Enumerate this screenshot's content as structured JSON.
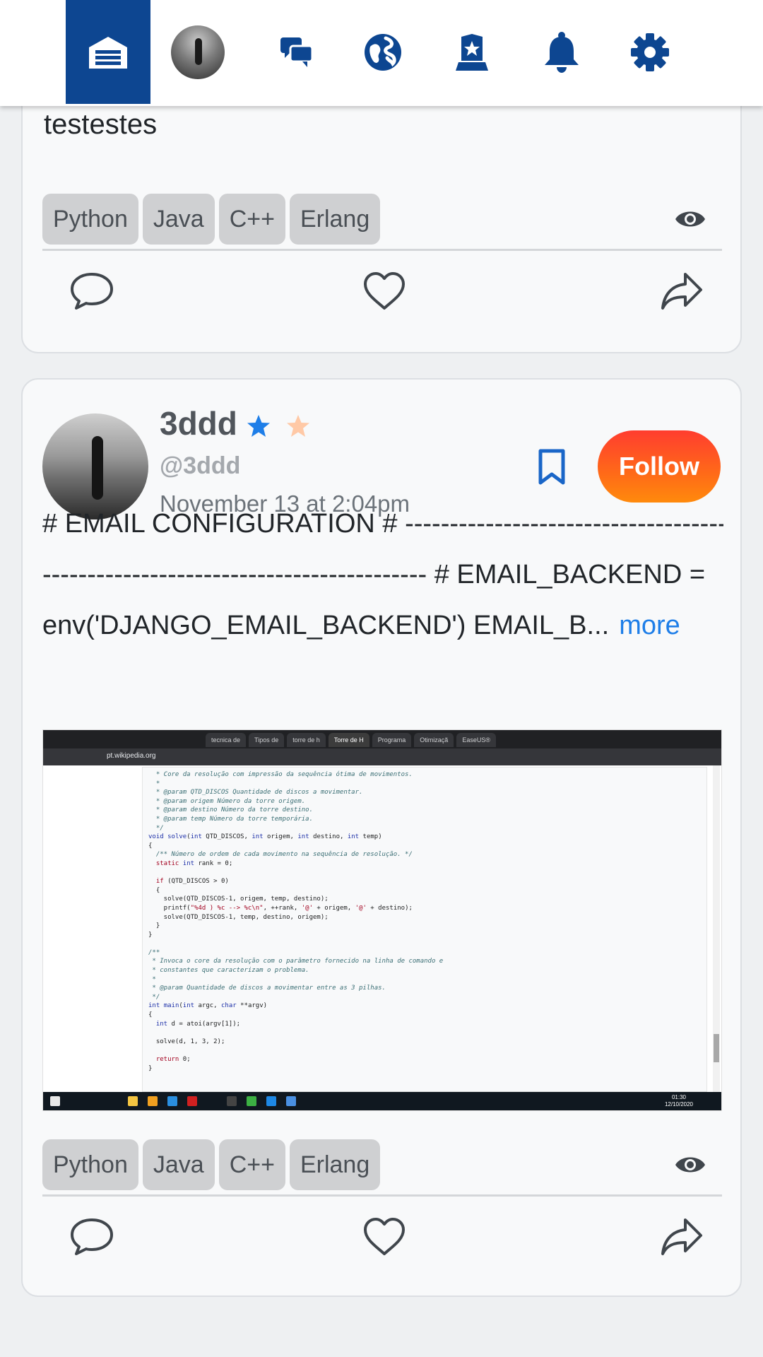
{
  "nav": {
    "items": [
      {
        "name": "home",
        "icon": "home-icon",
        "active": true
      },
      {
        "name": "profile",
        "icon": "avatar"
      },
      {
        "name": "messages",
        "icon": "chat-icon"
      },
      {
        "name": "explore",
        "icon": "globe-icon"
      },
      {
        "name": "ranking",
        "icon": "rank-badge-icon"
      },
      {
        "name": "notifications",
        "icon": "bell-icon"
      },
      {
        "name": "settings",
        "icon": "gear-icon"
      }
    ],
    "active_color": "#0d4691"
  },
  "posts": [
    {
      "body_text": "testestes",
      "tags": [
        "Python",
        "Java",
        "C++",
        "Erlang"
      ]
    },
    {
      "username": "3ddd",
      "handle": "@3ddd",
      "timestamp": "November 13 at 2:04pm",
      "follow_label": "Follow",
      "body_lines": [
        "# EMAIL CONFIGURATION # ---------------------------------------",
        "------------------------------------------- # EMAIL_BACKEND =",
        "env('DJANGO_EMAIL_BACKEND') EMAIL_B..."
      ],
      "more_label": "more",
      "tags": [
        "Python",
        "Java",
        "C++",
        "Erlang"
      ],
      "image": {
        "browser_tabs": [
          "tecnica de",
          "Tipos de",
          "torre de h",
          "Torre de H",
          "Programa",
          "Otimizaçã",
          "EaseUS®"
        ],
        "url": "pt.wikipedia.org",
        "clock_time": "01:30",
        "clock_date": "12/10/2020"
      }
    }
  ],
  "colors": {
    "accent": "#0d4691",
    "follow_gradient_start": "#ff3d2f",
    "follow_gradient_end": "#ff8a0c",
    "link": "#1e7ee8",
    "star_primary": "#1e7ee8",
    "star_secondary": "#ffc9a6"
  }
}
